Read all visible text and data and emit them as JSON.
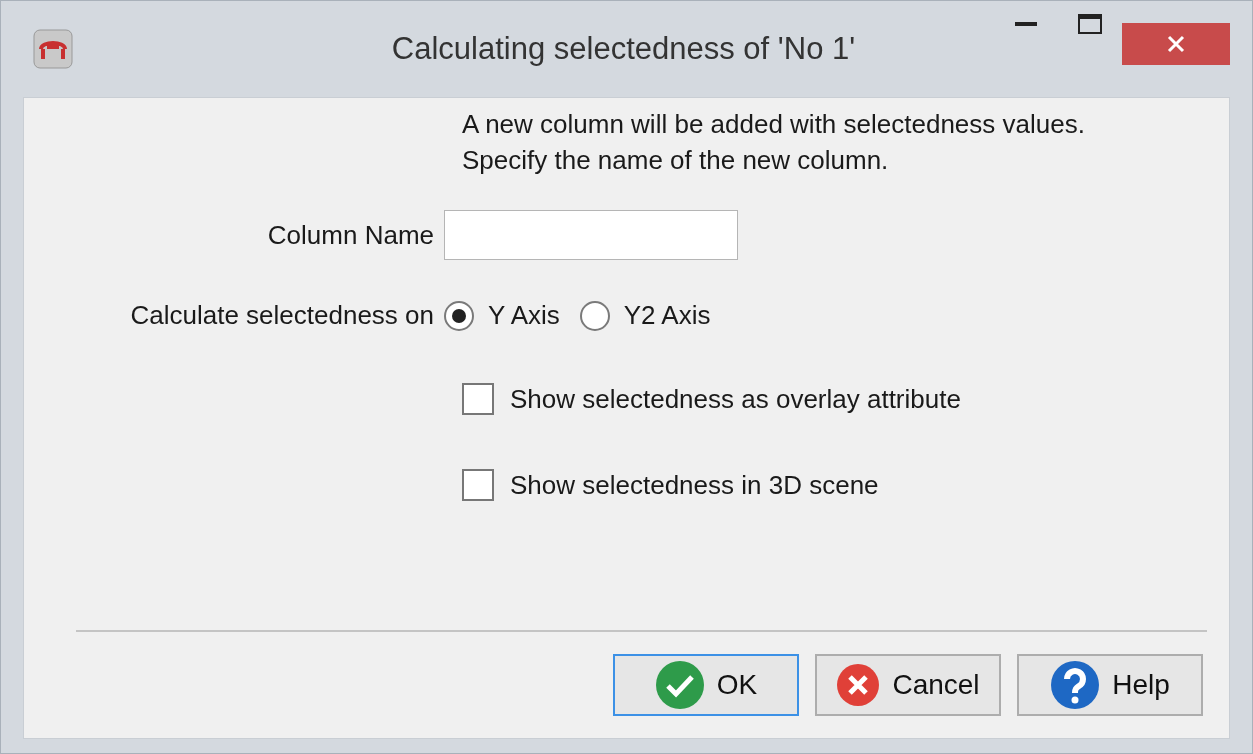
{
  "window": {
    "title": "Calculating selectedness of 'No 1'"
  },
  "intro": [
    "A new column will be added with selectedness values.",
    "Specify the name of the new column."
  ],
  "column_name": {
    "label": "Column Name"
  },
  "axis": {
    "label": "Calculate selectedness on",
    "options": [
      {
        "label": "Y Axis",
        "selected": true
      },
      {
        "label": "Y2 Axis",
        "selected": false
      }
    ]
  },
  "options": [
    {
      "label": "Show selectedness as overlay attribute",
      "checked": false
    },
    {
      "label": "Show selectedness in 3D scene",
      "checked": false
    }
  ],
  "buttons": [
    {
      "kind": "ok",
      "label": "OK",
      "focused": true
    },
    {
      "kind": "cancel",
      "label": "Cancel",
      "focused": false
    },
    {
      "kind": "help",
      "label": "Help",
      "focused": false
    }
  ]
}
